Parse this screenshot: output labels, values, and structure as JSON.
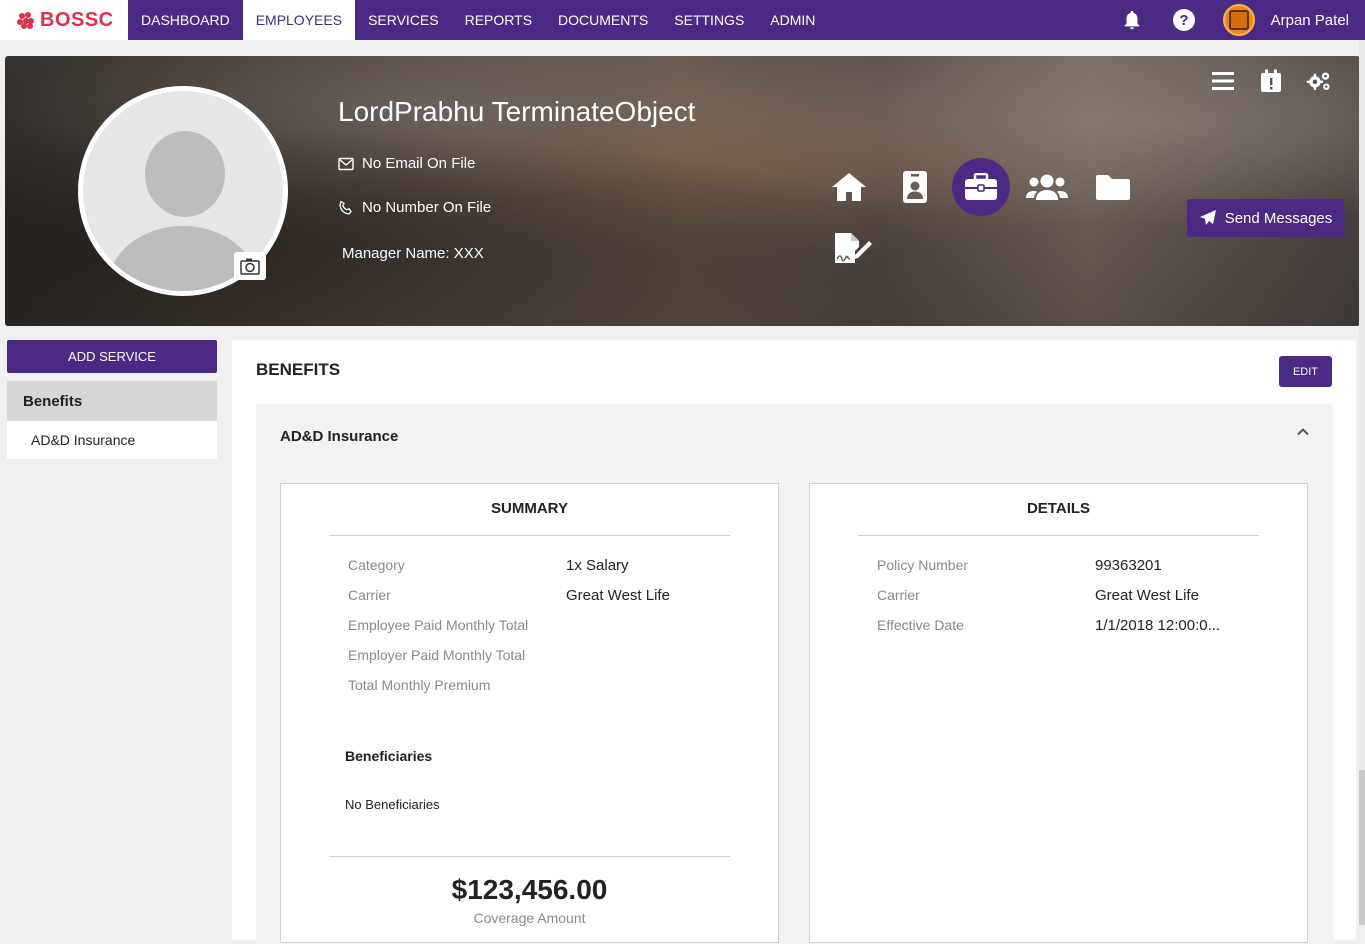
{
  "app": {
    "logo_text": "BOSSC"
  },
  "nav": {
    "items": [
      {
        "label": "DASHBOARD"
      },
      {
        "label": "EMPLOYEES",
        "active": true
      },
      {
        "label": "SERVICES"
      },
      {
        "label": "REPORTS"
      },
      {
        "label": "DOCUMENTS"
      },
      {
        "label": "SETTINGS"
      },
      {
        "label": "ADMIN"
      }
    ],
    "user_name": "Arpan Patel",
    "icons": [
      "bell-icon",
      "help-icon"
    ]
  },
  "profile": {
    "name": "LordPrabhu TerminateObject",
    "email": "No Email On File",
    "phone": "No Number On File",
    "manager": "Manager Name: XXX",
    "send_messages_label": "Send Messages",
    "section_icons": [
      "home-icon",
      "id-badge-icon",
      "briefcase-icon",
      "users-icon",
      "folder-icon",
      "signature-icon"
    ],
    "tool_icons": [
      "menu-icon",
      "calendar-alert-icon",
      "gears-icon"
    ]
  },
  "sidebar": {
    "add_service_label": "ADD SERVICE",
    "group_label": "Benefits",
    "items": [
      {
        "label": "AD&D Insurance"
      }
    ]
  },
  "main": {
    "title": "BENEFITS",
    "edit_label": "EDIT",
    "accordion_title": "AD&D Insurance",
    "summary": {
      "title": "SUMMARY",
      "rows": [
        {
          "label": "Category",
          "value": "1x Salary"
        },
        {
          "label": "Carrier",
          "value": "Great West Life"
        },
        {
          "label": "Employee Paid Monthly Total",
          "value": ""
        },
        {
          "label": "Employer Paid Monthly Total",
          "value": ""
        },
        {
          "label": "Total Monthly Premium",
          "value": ""
        }
      ],
      "beneficiaries_title": "Beneficiaries",
      "beneficiaries_text": "No Beneficiaries",
      "coverage_amount": "$123,456.00",
      "coverage_label": "Coverage Amount"
    },
    "details": {
      "title": "DETAILS",
      "rows": [
        {
          "label": "Policy Number",
          "value": "99363201"
        },
        {
          "label": "Carrier",
          "value": "Great West Life"
        },
        {
          "label": "Effective Date",
          "value": "1/1/2018 12:00:0..."
        }
      ]
    }
  },
  "colors": {
    "primary": "#4a2a85",
    "logo": "#e0314b"
  }
}
